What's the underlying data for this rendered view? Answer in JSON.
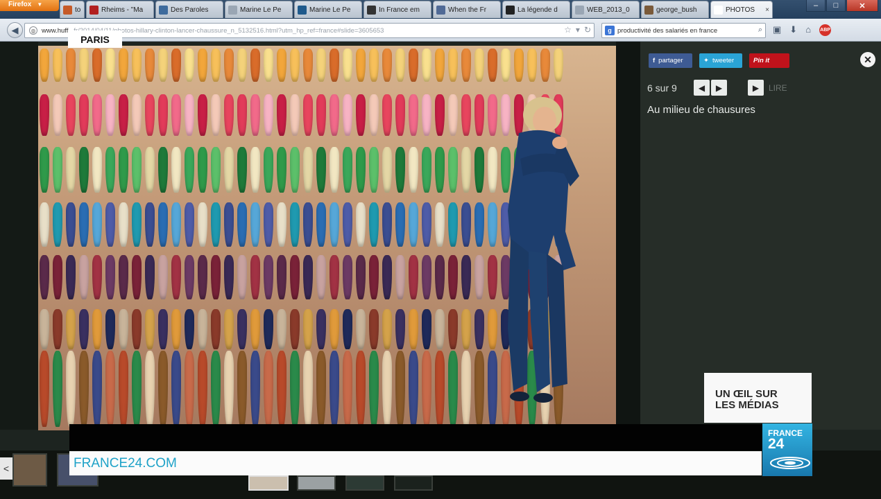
{
  "browser": {
    "app_button": "Firefox",
    "tabs": [
      {
        "label": "tol",
        "favicon": "#c65a28"
      },
      {
        "label": "Rheims - \"Ma",
        "favicon": "#b22020"
      },
      {
        "label": "Des Paroles",
        "favicon": "#3e6b9d"
      },
      {
        "label": "Marine Le Pe",
        "favicon": "#9aa6b4"
      },
      {
        "label": "Marine Le Pe",
        "favicon": "#1f5a8c"
      },
      {
        "label": "In France em",
        "favicon": "#333333"
      },
      {
        "label": "When the Fr",
        "favicon": "#506a96"
      },
      {
        "label": "La légende d",
        "favicon": "#222222"
      },
      {
        "label": "WEB_2013_0",
        "favicon": "#9aa6b4"
      },
      {
        "label": "george_bush",
        "favicon": "#7a5a3a"
      },
      {
        "label": "PHOTOS",
        "favicon": "#ffffff"
      }
    ],
    "window_controls": [
      "–",
      "□",
      "✕"
    ],
    "url_domain": "www.huff",
    "url_path": "...fr/2014/04/11/photos-hillary-clinton-lancer-chaussure_n_5132516.html?utm_hp_ref=france#slide=3605653",
    "search_value": "productivité des salariés en france",
    "search_engine": "Google"
  },
  "overlay": {
    "location": "PARIS",
    "segment_line1": "UN ŒIL SUR",
    "segment_line2": "LES MÉDIAS",
    "ticker": "FRANCE24.COM",
    "logo_line1": "FRANCE",
    "logo_line2": "24"
  },
  "gallery": {
    "share_facebook": "partager",
    "share_twitter": "tweeter",
    "share_pinterest": "Pin it",
    "close": "✕",
    "counter": "6 sur 9",
    "prev": "◀",
    "next": "▶",
    "play": "▶",
    "autoplay": "LIRE",
    "caption": "Au milieu de chausures"
  },
  "colors": {
    "france24_blue": "#1ea2c8",
    "pinterest_red": "#c0121b",
    "facebook_blue": "#3e5b94",
    "twitter_blue": "#2aa4d6"
  }
}
